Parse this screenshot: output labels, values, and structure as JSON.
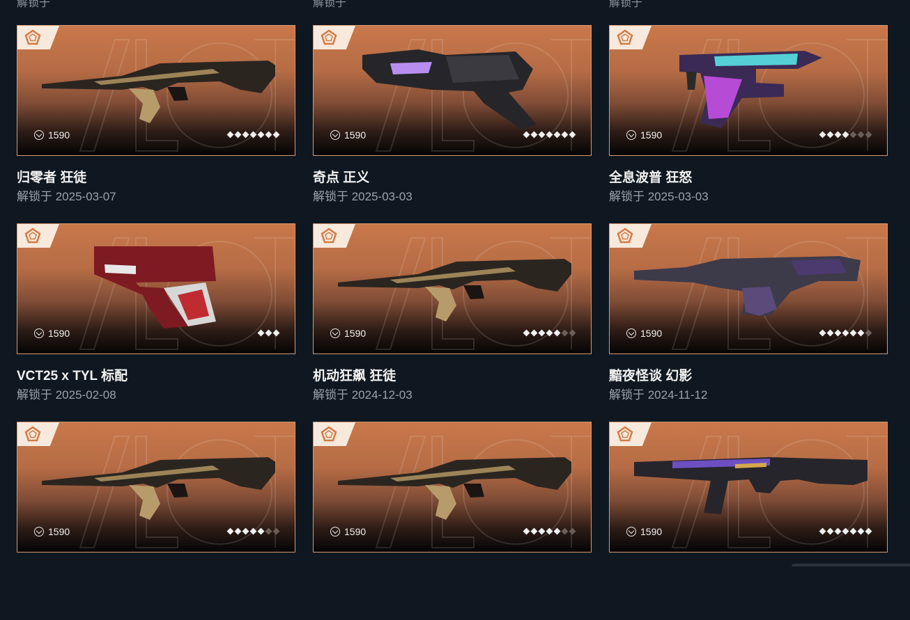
{
  "colors": {
    "background": "#0f1821",
    "card_border": "#d69a72",
    "card_top": "#c9784a",
    "level_on": "#f0f0f0",
    "level_off": "#6b5e57"
  },
  "previous_row_dates": [
    "解锁于",
    "解锁于",
    "解锁于"
  ],
  "items": [
    {
      "name": "归零者 狂徒",
      "date": "解锁于 2025-03-07",
      "price": "1590",
      "icon": "vp-currency-icon",
      "levels_total": 7,
      "levels_filled": 7,
      "weapon": "vandal"
    },
    {
      "name": "奇点 正义",
      "date": "解锁于 2025-03-03",
      "price": "1590",
      "icon": "vp-currency-icon",
      "levels_total": 7,
      "levels_filled": 7,
      "weapon": "sheriff"
    },
    {
      "name": "全息波普 狂怒",
      "date": "解锁于 2025-03-03",
      "price": "1590",
      "icon": "vp-currency-icon",
      "levels_total": 7,
      "levels_filled": 4,
      "weapon": "frenzy"
    },
    {
      "name": "VCT25 x TYL 标配",
      "date": "解锁于 2025-02-08",
      "price": "1590",
      "icon": "vp-currency-icon",
      "levels_total": 3,
      "levels_filled": 3,
      "weapon": "classic"
    },
    {
      "name": "机动狂飙 狂徒",
      "date": "解锁于 2024-12-03",
      "price": "1590",
      "icon": "vp-currency-icon",
      "levels_total": 7,
      "levels_filled": 5,
      "weapon": "vandal"
    },
    {
      "name": "黯夜怪谈 幻影",
      "date": "解锁于 2024-11-12",
      "price": "1590",
      "icon": "vp-currency-icon",
      "levels_total": 7,
      "levels_filled": 6,
      "weapon": "phantom"
    },
    {
      "name": "",
      "date": "",
      "price": "1590",
      "icon": "vp-currency-icon",
      "levels_total": 7,
      "levels_filled": 5,
      "weapon": "vandal"
    },
    {
      "name": "",
      "date": "",
      "price": "1590",
      "icon": "vp-currency-icon",
      "levels_total": 7,
      "levels_filled": 5,
      "weapon": "vandal"
    },
    {
      "name": "",
      "date": "",
      "price": "1590",
      "icon": "vp-currency-icon",
      "levels_total": 7,
      "levels_filled": 7,
      "weapon": "spectre"
    }
  ]
}
